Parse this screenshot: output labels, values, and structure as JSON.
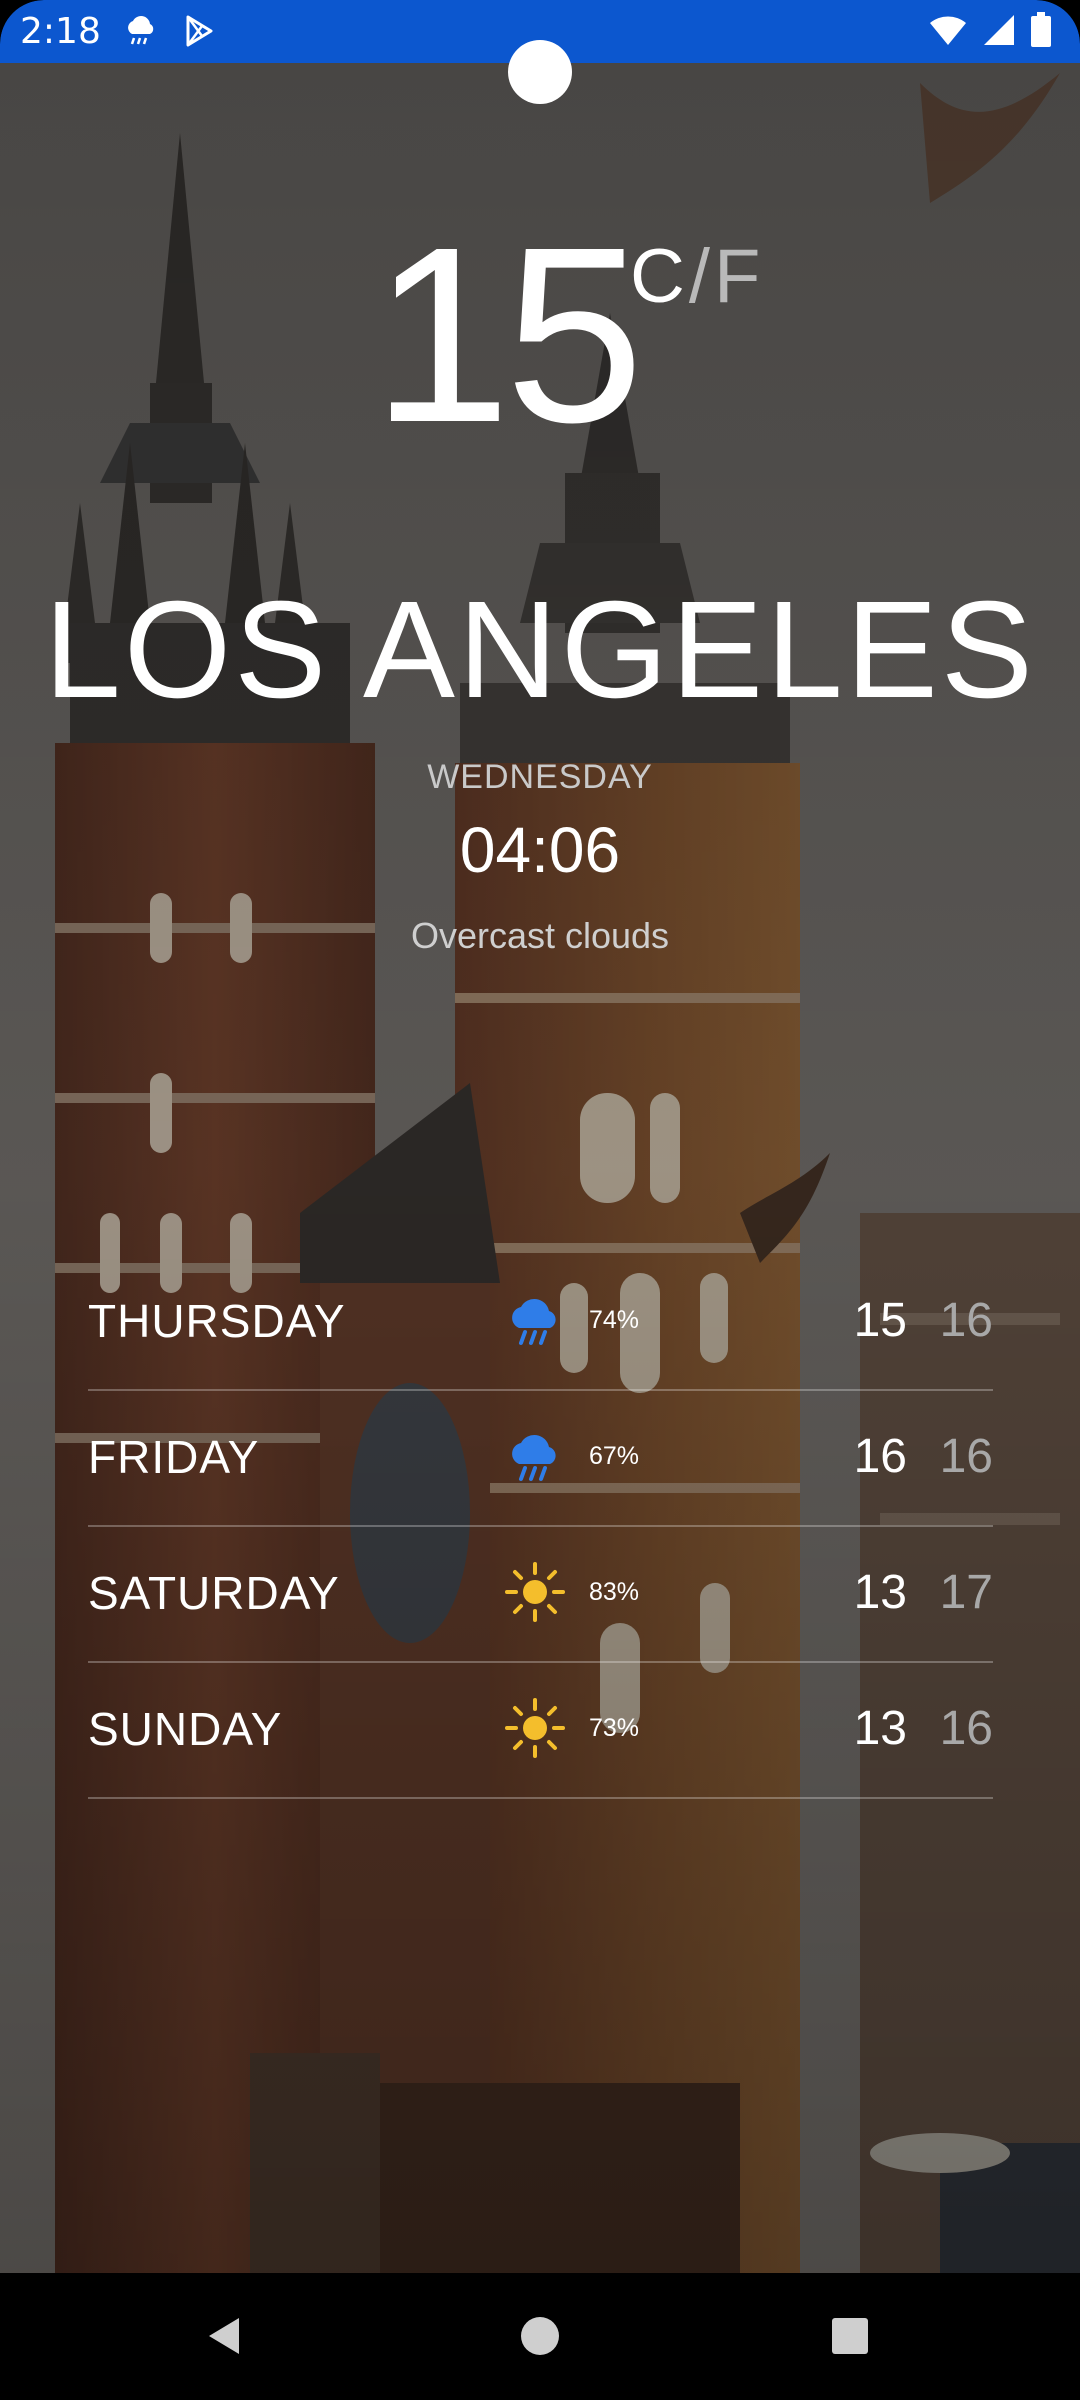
{
  "status_bar": {
    "time": "2:18",
    "background_color": "#0c57cf",
    "left_icons": [
      "rain-cloud-icon",
      "play-store-icon"
    ],
    "right_icons": [
      "wifi-icon",
      "cell-signal-icon",
      "battery-icon"
    ]
  },
  "weather": {
    "temperature": "15",
    "unit_celsius": "C",
    "unit_separator": "/",
    "unit_fahrenheit": "F",
    "city": "LOS ANGELES",
    "weekday": "WEDNESDAY",
    "time": "04:06",
    "condition": "Overcast clouds"
  },
  "forecast": [
    {
      "day": "THURSDAY",
      "icon": "rain-cloud-icon",
      "humidity": "74%",
      "high": "15",
      "low": "16"
    },
    {
      "day": "FRIDAY",
      "icon": "rain-cloud-icon",
      "humidity": "67%",
      "high": "16",
      "low": "16"
    },
    {
      "day": "SATURDAY",
      "icon": "sun-icon",
      "humidity": "83%",
      "high": "13",
      "low": "17"
    },
    {
      "day": "SUNDAY",
      "icon": "sun-icon",
      "humidity": "73%",
      "high": "13",
      "low": "16"
    }
  ],
  "colors": {
    "rain_icon": "#2f7de8",
    "sun_icon": "#f4be2c",
    "secondary_text": "#a8a8a8"
  },
  "nav_bar": {
    "icons": [
      "back-icon",
      "home-icon",
      "recents-icon"
    ]
  }
}
